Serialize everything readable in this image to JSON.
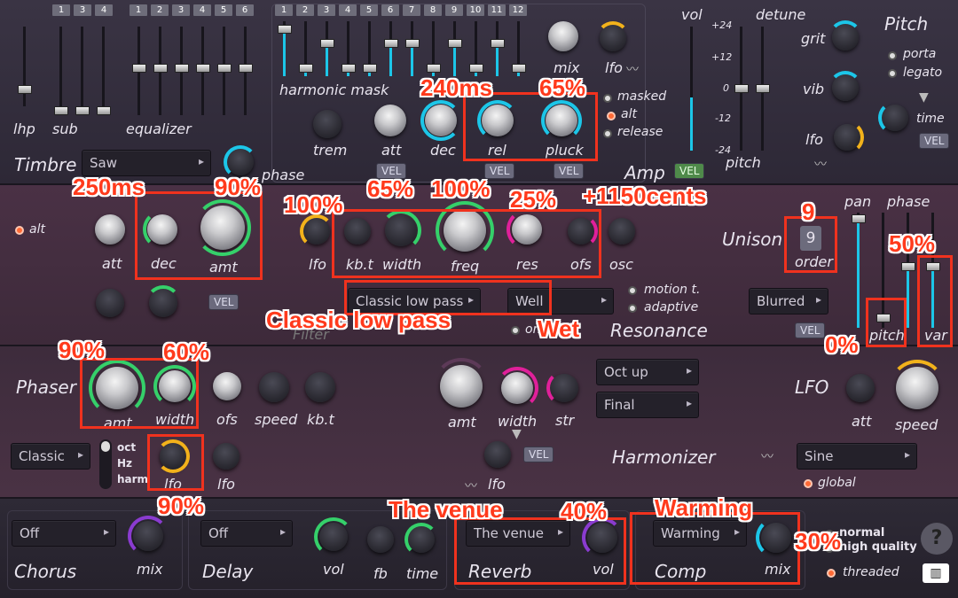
{
  "colors": {
    "accent_cyan": "#1cc6e8",
    "accent_green": "#35d06a",
    "accent_magenta": "#e0209a",
    "accent_yellow": "#f2b21b",
    "annotation_red": "#f0321e"
  },
  "timbre": {
    "title": "Timbre",
    "lhp": "lhp",
    "sub": "sub",
    "equalizer": "equalizer",
    "sub_nums": [
      "1",
      "3",
      "4"
    ],
    "eq_nums": [
      "1",
      "2",
      "3",
      "4",
      "5",
      "6"
    ],
    "harm_nums": [
      "1",
      "2",
      "3",
      "4",
      "5",
      "6",
      "7",
      "8",
      "9",
      "10",
      "11",
      "12"
    ],
    "harmonic_mask": "harmonic mask",
    "waveform": "Saw",
    "phase": "phase"
  },
  "amp": {
    "title": "Amp",
    "mix": "mix",
    "lfo": "lfo",
    "trem": "trem",
    "att": "att",
    "dec": "dec",
    "rel": "rel",
    "pluck": "pluck",
    "vel": "VEL",
    "mode_options": [
      "masked",
      "alt",
      "release"
    ],
    "selected_mode": "alt"
  },
  "pitch": {
    "title": "Pitch",
    "vol": "vol",
    "detune": "detune",
    "pitch": "pitch",
    "scale": [
      "+24",
      "+12",
      "0",
      "-12",
      "-24"
    ],
    "grit": "grit",
    "vib": "vib",
    "lfo": "lfo",
    "time": "time",
    "glide_options": [
      "porta",
      "legato"
    ],
    "vel": "VEL"
  },
  "filter": {
    "title": "Filter",
    "alt": "alt",
    "att": "att",
    "dec": "dec",
    "amt": "amt",
    "lfo": "lfo",
    "kbt": "kb.t",
    "width": "width",
    "freq": "freq",
    "res": "res",
    "ofs": "ofs",
    "osc": "osc",
    "type": "Classic low pass",
    "resonance_type": "Well",
    "resonance": "Resonance",
    "motion_options": [
      "motion t.",
      "adaptive"
    ],
    "vel": "VEL",
    "on_label": "on"
  },
  "unison": {
    "title": "Unison",
    "order": "order",
    "order_value": "9",
    "pan": "pan",
    "phase": "phase",
    "pitch": "pitch",
    "var": "var",
    "spread_type": "Blurred",
    "vel": "VEL"
  },
  "phaser": {
    "title": "Phaser",
    "amt": "amt",
    "width": "width",
    "ofs": "ofs",
    "speed": "speed",
    "kbt": "kb.t",
    "type": "Classic",
    "lfo": "lfo",
    "lfo2": "lfo",
    "units": [
      "oct",
      "Hz",
      "harm"
    ]
  },
  "harmonizer": {
    "title": "Harmonizer",
    "amt": "amt",
    "width": "width",
    "str": "str",
    "lfo": "lfo",
    "mode1": "Oct up",
    "mode2": "Final",
    "vel": "VEL"
  },
  "lfo_section": {
    "title": "LFO",
    "att": "att",
    "speed": "speed",
    "shape": "Sine",
    "global": "global"
  },
  "bottom": {
    "chorus": "Chorus",
    "chorus_type": "Off",
    "mix": "mix",
    "delay": "Delay",
    "delay_type": "Off",
    "vol": "vol",
    "fb": "fb",
    "time": "time",
    "reverb": "Reverb",
    "reverb_type": "The venue",
    "reverb_vol": "vol",
    "comp": "Comp",
    "comp_type": "Warming",
    "comp_mix": "mix",
    "quality_options": [
      "normal",
      "high quality"
    ],
    "threaded": "threaded",
    "help": "?"
  },
  "annotations": {
    "rel": "240ms",
    "pluck": "65%",
    "dec": "250ms",
    "amt": "90%",
    "lfo": "100%",
    "width": "65%",
    "freq": "100%",
    "res": "25%",
    "ofs": "+1150cents",
    "order": "9",
    "var": "50%",
    "pitch": "0%",
    "filter_type": "Classic low pass",
    "resonance_type": "Wet",
    "phaser_amt": "90%",
    "phaser_width": "60%",
    "phaser_lfo": "90%",
    "reverb": "The venue",
    "reverb_vol": "40%",
    "comp": "Warming",
    "comp_mix": "30%"
  }
}
